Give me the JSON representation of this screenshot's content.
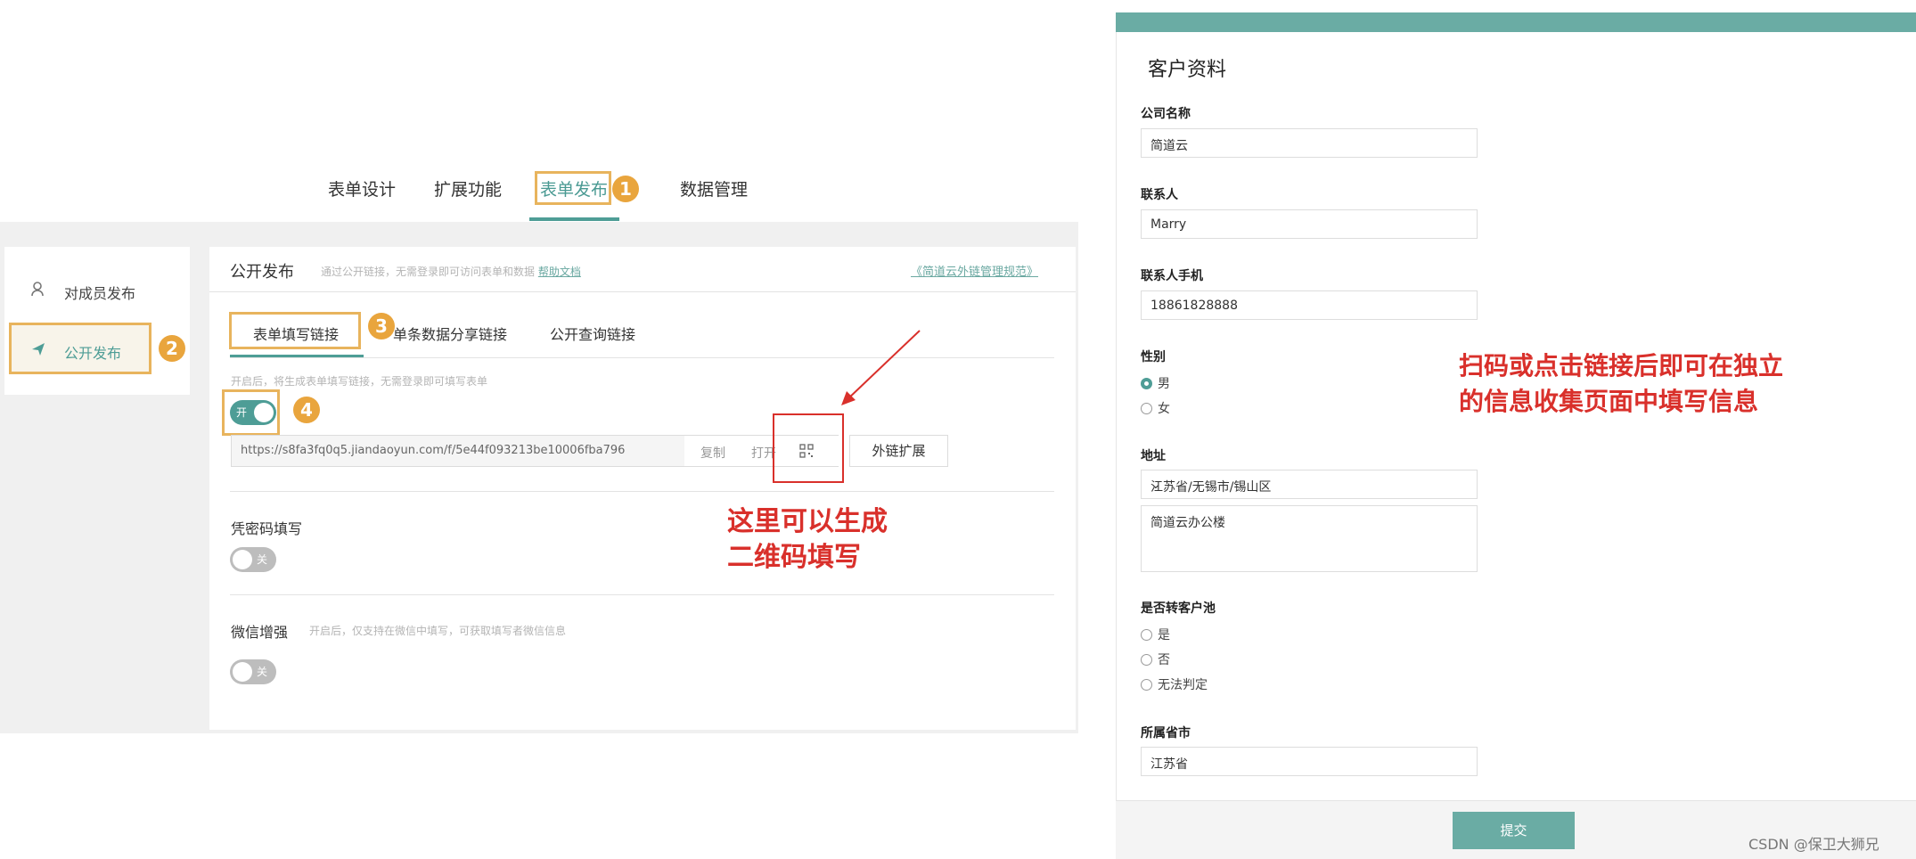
{
  "top_tabs": [
    "表单设计",
    "扩展功能",
    "表单发布",
    "数据管理"
  ],
  "badges": [
    "1",
    "2",
    "3",
    "4"
  ],
  "sidebar": {
    "items": [
      {
        "label": "对成员发布",
        "icon": "user-icon"
      },
      {
        "label": "公开发布",
        "icon": "send-icon"
      }
    ]
  },
  "panel": {
    "title": "公开发布",
    "desc": "通过公开链接，无需登录即可访问表单和数据",
    "help_link": "帮助文档",
    "rule_link": "《简道云外链管理规范》",
    "sub_tabs": [
      "表单填写链接",
      "单条数据分享链接",
      "公开查询链接"
    ],
    "hint": "开启后，将生成表单填写链接，无需登录即可填写表单",
    "toggle_on_text": "开",
    "url": "https://s8fa3fq0q5.jiandaoyun.com/f/5e44f093213be10006fba796",
    "copy": "复制",
    "open": "打开",
    "qr": "🀄",
    "ext_button": "外链扩展",
    "password_label": "凭密码填写",
    "toggle_off_text": "关",
    "wechat_label": "微信增强",
    "wechat_hint": "开启后，仅支持在微信中填写，可获取填写者微信信息"
  },
  "annotations": {
    "qr_note_line1": "这里可以生成",
    "qr_note_line2": "二维码填写",
    "form_note_line1": "扫码或点击链接后即可在独立",
    "form_note_line2": "的信息收集页面中填写信息"
  },
  "colors": {
    "accent": "#4e9d96",
    "orange": "#e9a53d",
    "red": "#d9302b"
  },
  "form": {
    "title": "客户资料",
    "company_label": "公司名称",
    "company_value": "简道云",
    "contact_label": "联系人",
    "contact_value": "Marry",
    "phone_label": "联系人手机",
    "phone_value": "18861828888",
    "gender_label": "性别",
    "gender_options": [
      "男",
      "女"
    ],
    "gender_selected": "男",
    "address_label": "地址",
    "address_region": "江苏省/无锡市/锡山区",
    "address_detail": "简道云办公楼",
    "pool_label": "是否转客户池",
    "pool_options": [
      "是",
      "否",
      "无法判定"
    ],
    "province_label": "所属省市",
    "province_value": "江苏省",
    "submit": "提交"
  },
  "watermark": "CSDN @保卫大狮兄"
}
